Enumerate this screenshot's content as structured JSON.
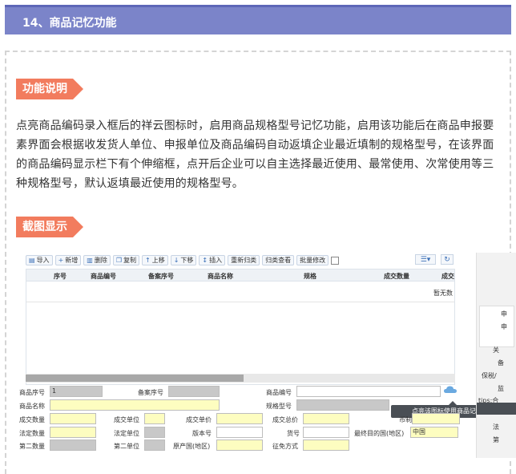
{
  "header": {
    "title": "14、商品记忆功能"
  },
  "sections": {
    "desc_tag": "功能说明",
    "shot_tag": "截图显示"
  },
  "description": "点亮商品编码录入框后的祥云图标时，启用商品规格型号记忆功能，启用该功能后在商品申报要素界面会根据收发货人单位、申报单位及商品编码自动返填企业最近填制的规格型号，在该界面的商品编码显示栏下有个伸缩框，点开后企业可以自主选择最近使用、最常使用、次常使用等三种规格型号，默认返填最近使用的规格型号。",
  "screenshot": {
    "toolbar": [
      "导入",
      "新增",
      "删除",
      "复制",
      "上移",
      "下移",
      "插入",
      "重新归类",
      "归类查看",
      "批量修改"
    ],
    "toolbar_icons": [
      "import-icon",
      "plus-icon",
      "trash-icon",
      "copy-icon",
      "arrow-up-icon",
      "arrow-down-icon",
      "insert-icon",
      "",
      "",
      ""
    ],
    "grid_headers": [
      "序号",
      "商品编号",
      "备案序号",
      "商品名称",
      "规格",
      "成交数量",
      "成交"
    ],
    "grid_empty": "暂无数",
    "form": {
      "item_no_label": "商品序号",
      "item_no_value": "1",
      "record_no_label": "备案序号",
      "code_label": "商品编号",
      "name_label": "商品名称",
      "spec_label": "规格型号",
      "qty_label": "成交数量",
      "unit_label": "成交单位",
      "price_label": "成交单价",
      "total_label": "成交总价",
      "currency_label": "币制",
      "legal_qty_label": "法定数量",
      "legal_unit_label": "法定单位",
      "version_label": "版本号",
      "goods_no_label": "货号",
      "dest_label": "最终目的国(地区)",
      "dest_value": "中国",
      "second_qty_label": "第二数量",
      "second_unit_label": "第二单位",
      "origin_label": "原产国(地区)",
      "tax_label": "征免方式"
    },
    "tooltip": "点亮该图标使用商品记忆功能",
    "side_texts": [
      "申",
      "申",
      "关",
      "备",
      "保税/",
      "监",
      "tips:合",
      "法",
      "第"
    ]
  }
}
